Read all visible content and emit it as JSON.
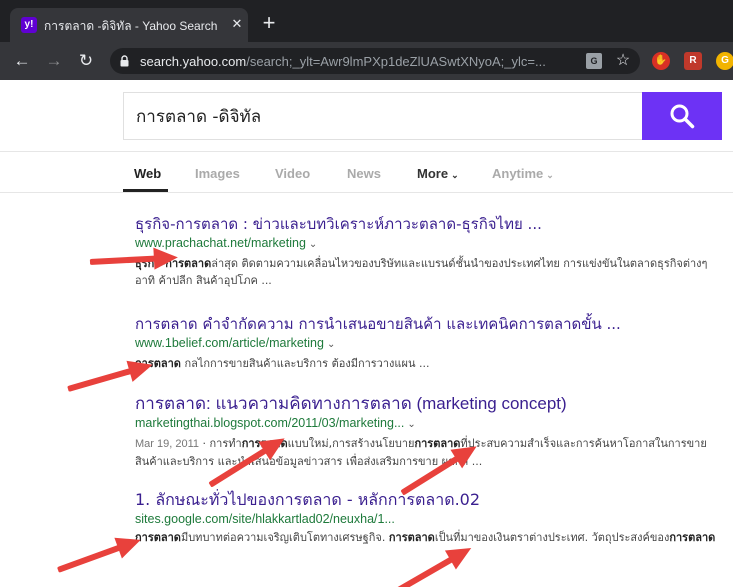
{
  "browser": {
    "tab_title": "การตลาด -ดิจิทัล - Yahoo Search Re",
    "favicon_text": "y!",
    "url_host": "search.yahoo.com",
    "url_path": "/search;_ylt=Awr9lmPXp1deZlUASwtXNyoA;_ylc=...",
    "colors": {
      "brand": "#6001d2",
      "button": "#6d32f5"
    }
  },
  "search": {
    "query": "การตลาด -ดิจิทัล"
  },
  "tabs": {
    "web": "Web",
    "images": "Images",
    "video": "Video",
    "news": "News",
    "more": "More",
    "anytime": "Anytime"
  },
  "results": [
    {
      "title": "ธุรกิจ-การตลาด : ข่าวและบทวิเคราะห์ภาวะตลาด-ธุรกิจไทย ...",
      "url": "www.prachachat.net/marketing",
      "snippet_bold": "ธุรกิจ-การตลาด",
      "snippet_rest": "ล่าสุด ติดตามความเคลื่อนไหวของบริษัทและแบรนด์ชั้นนำของประเทศไทย การแข่งขันในตลาดธุรกิจต่างๆ อาทิ ค้าปลีก สินค้าอุปโภค ..."
    },
    {
      "title": "การตลาด คำจำกัดความ การนำเสนอขายสินค้า และเทคนิคการตลาดขั้น ...",
      "url": "www.1belief.com/article/marketing",
      "snippet_bold": "การตลาด",
      "snippet_rest": " กลไกการขายสินค้าและบริการ ต้องมีการวางแผน ..."
    },
    {
      "title": "การตลาด: แนวความคิดทางการตลาด (marketing concept)",
      "url": "marketingthai.blogspot.com/2011/03/marketing...",
      "date": "Mar 19, 2011",
      "snippet_pre": " · การทำ",
      "snippet_bold": "การตลาด",
      "snippet_mid": "แบบใหม่,การสร้างนโยบาย",
      "snippet_bold2": "การตลาด",
      "snippet_rest": "ที่ประสบความสำเร็จและการค้นหาโอกาสในการขายสินค้าและบริการ และนำเสนอข้อมูลข่าวสาร เพื่อส่งเสริมการขาย ผลกล ..."
    },
    {
      "title": "1. ลักษณะทั่วไปของการตลาด - หลักการตลาด.02",
      "url": "sites.google.com/site/hlakkartlad02/neuxha/1...",
      "snippet_bold": "การตลาด",
      "snippet_mid": "มีบทบาทต่อความเจริญเติบโตทางเศรษฐกิจ. ",
      "snippet_bold2": "การตลาด",
      "snippet_mid2": "เป็นที่มาของเงินตราต่างประเทศ. วัตถุประสงค์ของ",
      "snippet_bold3": "การตลาด"
    }
  ]
}
